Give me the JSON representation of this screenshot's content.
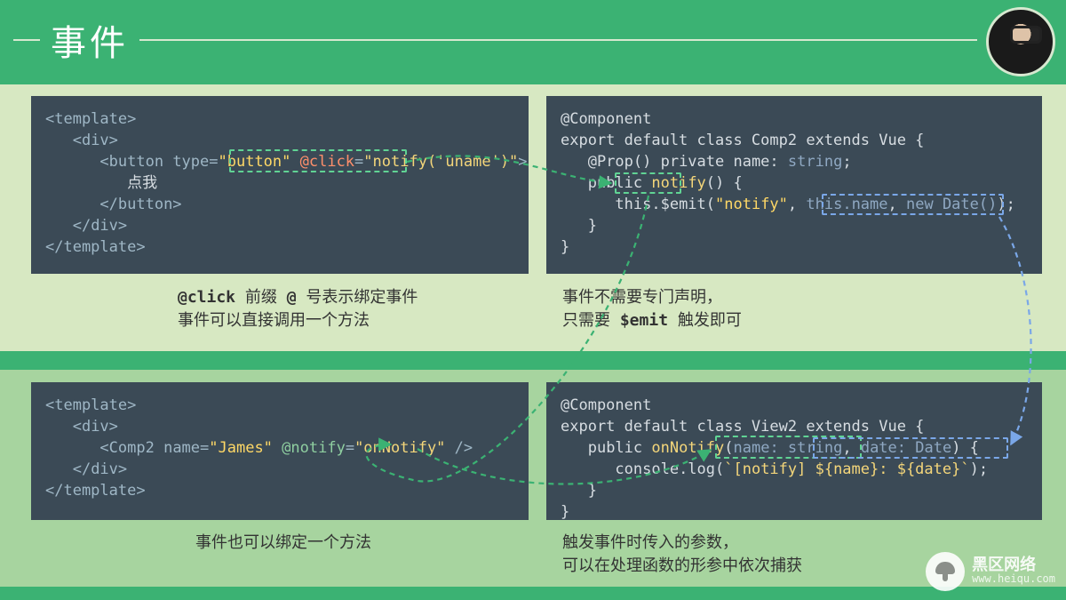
{
  "title": "事件",
  "code_tl": {
    "l1a": "<template>",
    "l2a": "<div>",
    "l3a": "<button",
    "l3b": " type=",
    "l3c": "\"button\"",
    "l3d": " @click",
    "l3e": "=",
    "l3f": "\"notify('uname')\"",
    "l3g": ">",
    "l4": "点我",
    "l5": "</button>",
    "l6": "</div>",
    "l7": "</template>"
  },
  "cap_tl_a": "@click",
  "cap_tl_b": "  前缀  ",
  "cap_tl_c": "@",
  "cap_tl_d": "  号表示绑定事件",
  "cap_tl_e": "事件可以直接调用一个方法",
  "code_tr": {
    "l1": "@Component",
    "l2": "export default class Comp2 extends Vue {",
    "l3a": "@Prop() private name: ",
    "l3b": "string",
    "l4a": "public ",
    "l4b": "notify",
    "l4c": "() {",
    "l5a": "this.$emit(",
    "l5b": "\"notify\"",
    "l5c": ", ",
    "l5d": "this.name",
    "l5e": ", ",
    "l5f": "new Date()",
    "l5g": ");",
    "l6": "}",
    "l7": "}"
  },
  "cap_tr_a": "事件不需要专门声明，",
  "cap_tr_b": "只需要  ",
  "cap_tr_c": "$emit",
  "cap_tr_d": "  触发即可",
  "code_bl": {
    "l1": "<template>",
    "l2": "<div>",
    "l3a": "<Comp2",
    "l3b": " name=",
    "l3c": "\"James\"",
    "l3d": " @notify",
    "l3e": "=",
    "l3f": "\"onNotify\"",
    "l3g": " />",
    "l4": "</div>",
    "l5": "</template>"
  },
  "cap_bl": "事件也可以绑定一个方法",
  "code_br": {
    "l1": "@Component",
    "l2": "export default class View2 extends Vue {",
    "l3a": "public ",
    "l3b": "onNotify",
    "l3c": "(",
    "l3d": "name: string",
    "l3e": ", ",
    "l3f": "date: Date",
    "l3g": ") {",
    "l4a": "console.log(",
    "l4b": "`[notify] ${name}: ${date}`",
    "l4c": ");",
    "l5": "}",
    "l6": "}"
  },
  "cap_br_a": "触发事件时传入的参数，",
  "cap_br_b": "可以在处理函数的形参中依次捕获",
  "watermark_cn": "黑区网络",
  "watermark_url": "www.heiqu.com"
}
